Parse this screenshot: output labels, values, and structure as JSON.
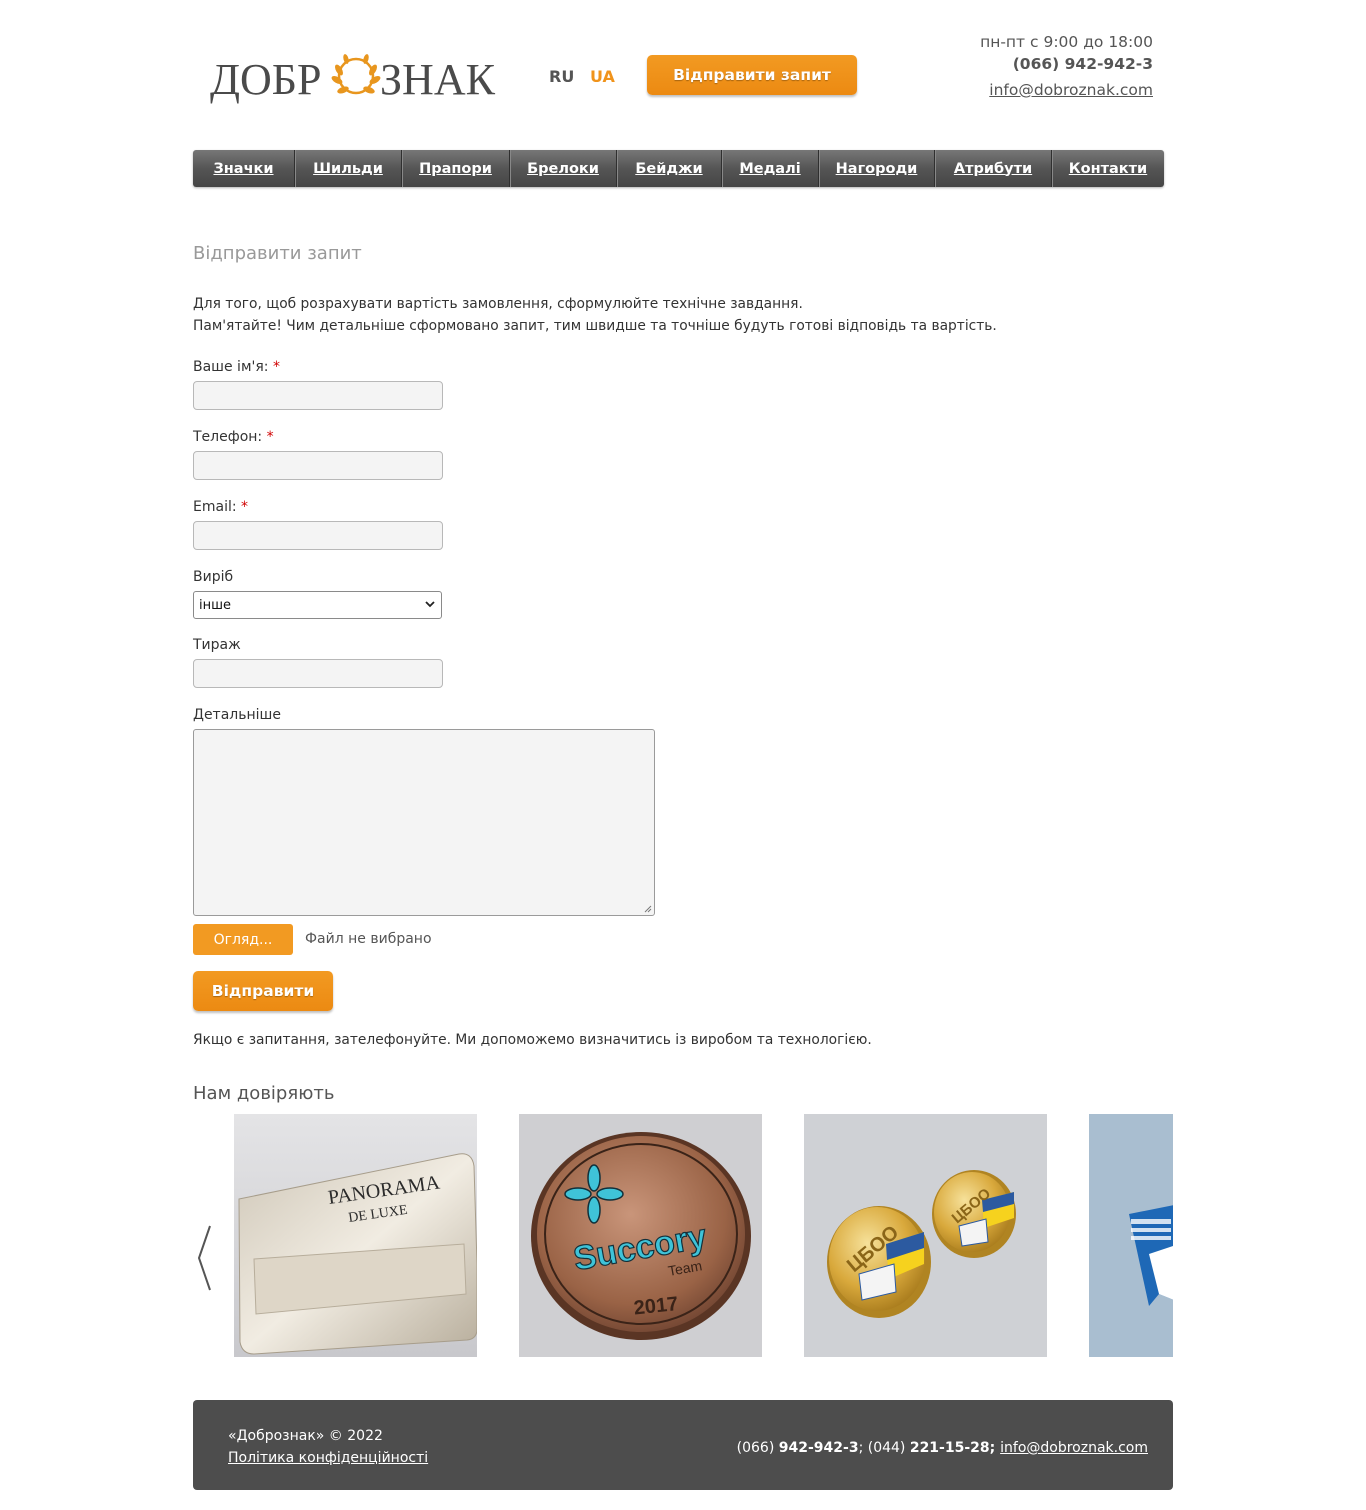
{
  "header": {
    "logo_text_left": "ДОБР",
    "logo_text_right": "ЗНАК",
    "lang_ru": "RU",
    "lang_ua": "UA",
    "request_button": "Відправити запит",
    "hours": "пн-пт с 9:00 до 18:00",
    "phone": "(066) 942-942-3",
    "email": "info@dobroznak.com"
  },
  "nav": {
    "items": [
      "Значки",
      "Шильди",
      "Прапори",
      "Брелоки",
      "Бейджи",
      "Медалі",
      "Нагороди",
      "Атрибути",
      "Контакти"
    ]
  },
  "form": {
    "title": "Відправити запит",
    "intro_line1": "Для того, щоб розрахувати вартість замовлення, сформулюйте технічне завдання.",
    "intro_line2": "Пам'ятайте! Чим детальніше сформовано запит, тим швидше та точніше будуть готові відповідь та вартість.",
    "name_label": "Ваше ім'я:",
    "phone_label": "Телефон:",
    "email_label": "Email:",
    "required_mark": "*",
    "product_label": "Виріб",
    "product_value": "інше",
    "quantity_label": "Тираж",
    "details_label": "Детальніше",
    "file_button": "Огляд...",
    "file_status": "Файл не вибрано",
    "submit": "Відправити",
    "help_text": "Якщо є запитання, зателефонуйте. Ми допоможемо визначитись із виробом та технологією."
  },
  "trust": {
    "title": "Нам довіряють",
    "slide1_text": "PANORAMA",
    "slide1_text2": "DE LUXE",
    "slide2_text": "Succory",
    "slide2_sub": "Team",
    "slide2_year": "2017",
    "slide3_text": "ЦБОО"
  },
  "footer": {
    "copyright": "«Добрознак» © 2022",
    "policy": "Політика конфіденційності",
    "phone1_prefix": "(066) ",
    "phone1": "942-942-3",
    "sep1": "; (044) ",
    "phone2": "221-15-28",
    "sep2": "; ",
    "email": "info@dobroznak.com"
  },
  "colors": {
    "accent": "#f0931b",
    "nav_bg": "#555555",
    "footer_bg": "#4d4d4d",
    "required": "#d00000"
  }
}
